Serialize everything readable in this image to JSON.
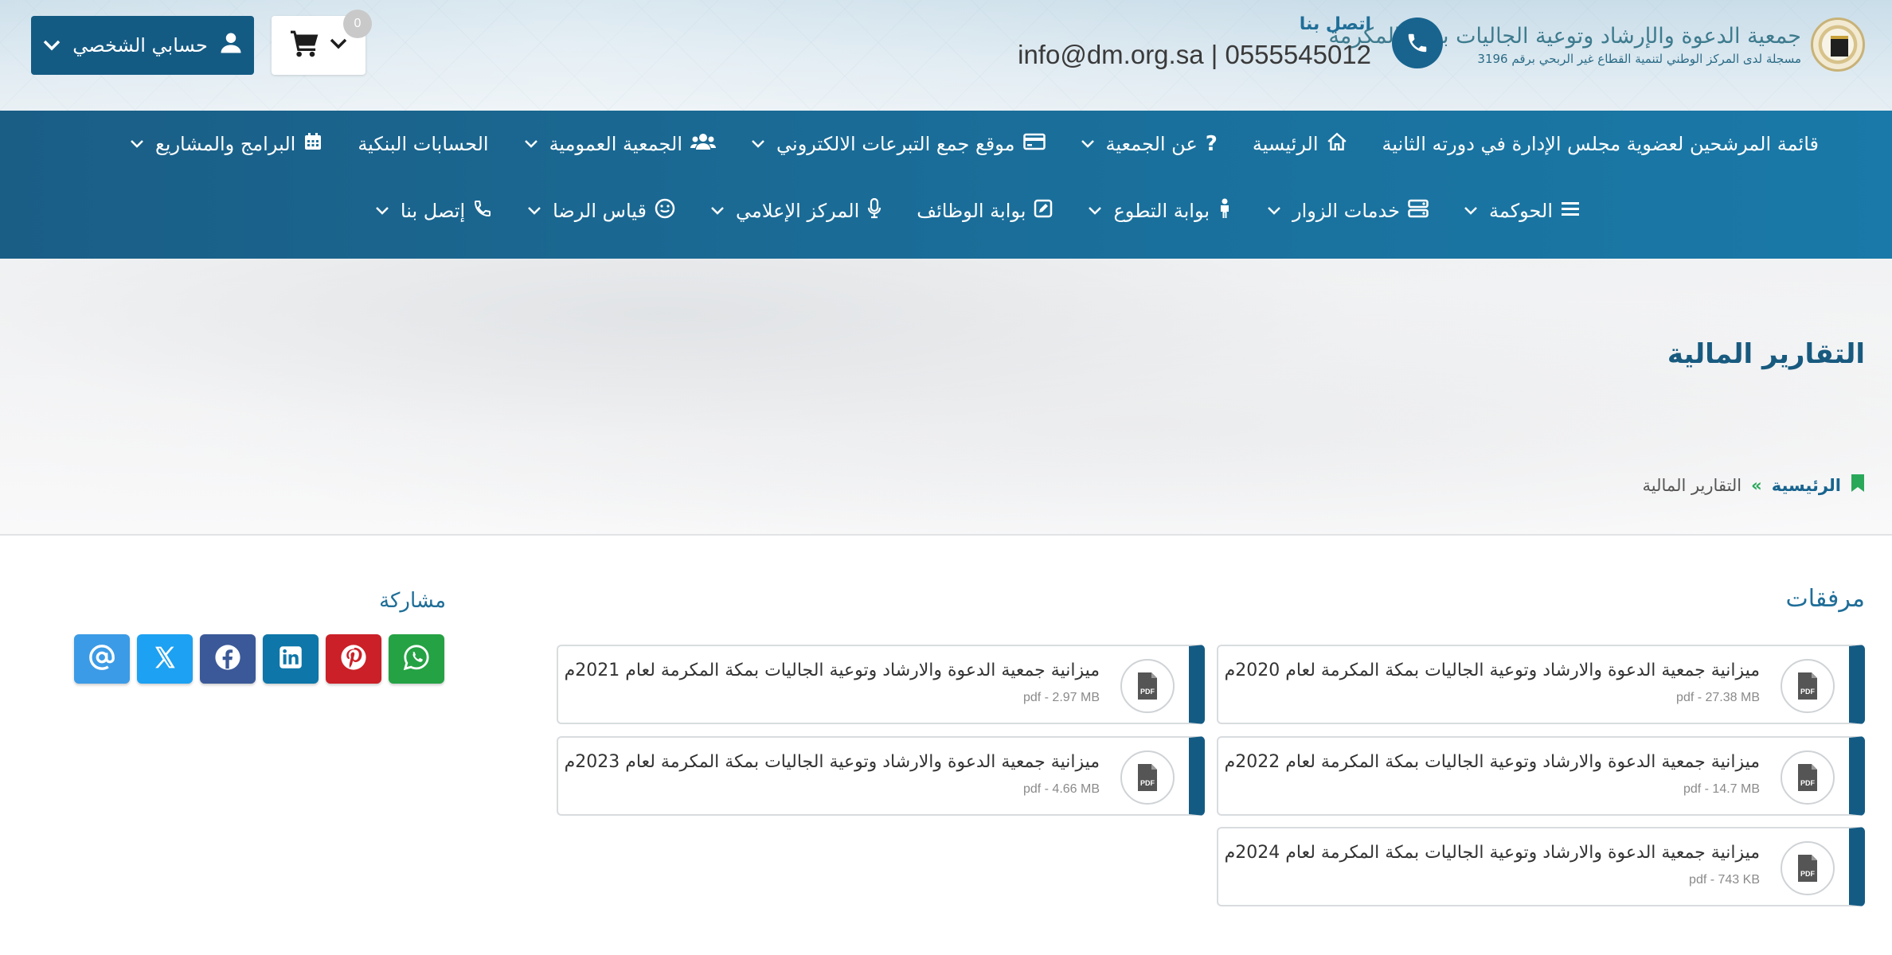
{
  "header": {
    "logo_title": "جمعية الدعوة والإرشاد وتوعية الجاليات بمكة المكرمة",
    "logo_subtitle": "مسجلة لدى المركز الوطني لتنمية القطاع غير الربحي برقم 3196",
    "contact_title": "اتصل بنا",
    "contact_line": "info@dm.org.sa | 0555545012",
    "account_label": "حسابي الشخصي",
    "cart_count": "0"
  },
  "nav": {
    "row1": [
      {
        "label": "قائمة المرشحين لعضوية مجلس الإدارة في دورته الثانية",
        "icon": "none",
        "dropdown": false
      },
      {
        "label": "الرئيسية",
        "icon": "home-icon",
        "dropdown": false
      },
      {
        "label": "عن الجمعية",
        "icon": "question-icon",
        "dropdown": true
      },
      {
        "label": "موقع جمع التبرعات الالكتروني",
        "icon": "credit-card-icon",
        "dropdown": true
      },
      {
        "label": "الجمعية العمومية",
        "icon": "users-icon",
        "dropdown": true
      },
      {
        "label": "الحسابات البنكية",
        "icon": "none",
        "dropdown": false
      },
      {
        "label": "البرامج والمشاريع",
        "icon": "calendar-icon",
        "dropdown": true
      }
    ],
    "row2": [
      {
        "label": "الحوكمة",
        "icon": "bars-icon",
        "dropdown": true
      },
      {
        "label": "خدمات الزوار",
        "icon": "server-icon",
        "dropdown": true
      },
      {
        "label": "بوابة التطوع",
        "icon": "person-icon",
        "dropdown": true
      },
      {
        "label": "بوابة الوظائف",
        "icon": "edit-icon",
        "dropdown": false
      },
      {
        "label": "المركز الإعلامي",
        "icon": "microphone-icon",
        "dropdown": true
      },
      {
        "label": "قياس الرضا",
        "icon": "smile-icon",
        "dropdown": true
      },
      {
        "label": "إتصل بنا",
        "icon": "phone-icon",
        "dropdown": true
      }
    ]
  },
  "hero": {
    "page_title": "التقارير المالية",
    "breadcrumb_home": "الرئيسية",
    "breadcrumb_sep": "»",
    "breadcrumb_current": "التقارير المالية"
  },
  "attachments": {
    "title": "مرفقات",
    "items": [
      {
        "name": "ميزانية جمعية الدعوة والارشاد وتوعية الجاليات بمكة المكرمة لعام 2020م",
        "meta": "pdf - 27.38 MB"
      },
      {
        "name": "ميزانية جمعية الدعوة والارشاد وتوعية الجاليات بمكة المكرمة لعام 2021م",
        "meta": "pdf - 2.97 MB"
      },
      {
        "name": "ميزانية جمعية الدعوة والارشاد وتوعية الجاليات بمكة المكرمة لعام 2022م",
        "meta": "pdf - 14.7 MB"
      },
      {
        "name": "ميزانية جمعية الدعوة والارشاد وتوعية الجاليات بمكة المكرمة لعام 2023م",
        "meta": "pdf - 4.66 MB"
      },
      {
        "name": "ميزانية جمعية الدعوة والارشاد وتوعية الجاليات بمكة المكرمة لعام 2024م",
        "meta": "pdf - 743 KB"
      }
    ]
  },
  "share": {
    "title": "مشاركة",
    "buttons": [
      {
        "icon": "email-icon",
        "color": "#3c9be6"
      },
      {
        "icon": "x-twitter-icon",
        "color": "#1da1f2"
      },
      {
        "icon": "facebook-icon",
        "color": "#3b5998"
      },
      {
        "icon": "linkedin-icon",
        "color": "#0e76a8"
      },
      {
        "icon": "pinterest-icon",
        "color": "#cb2027"
      },
      {
        "icon": "whatsapp-icon",
        "color": "#25a244"
      }
    ]
  },
  "colors": {
    "primary": "#145b84",
    "nav_bg": "#1a6d98",
    "accent_green": "#2aa85a"
  }
}
